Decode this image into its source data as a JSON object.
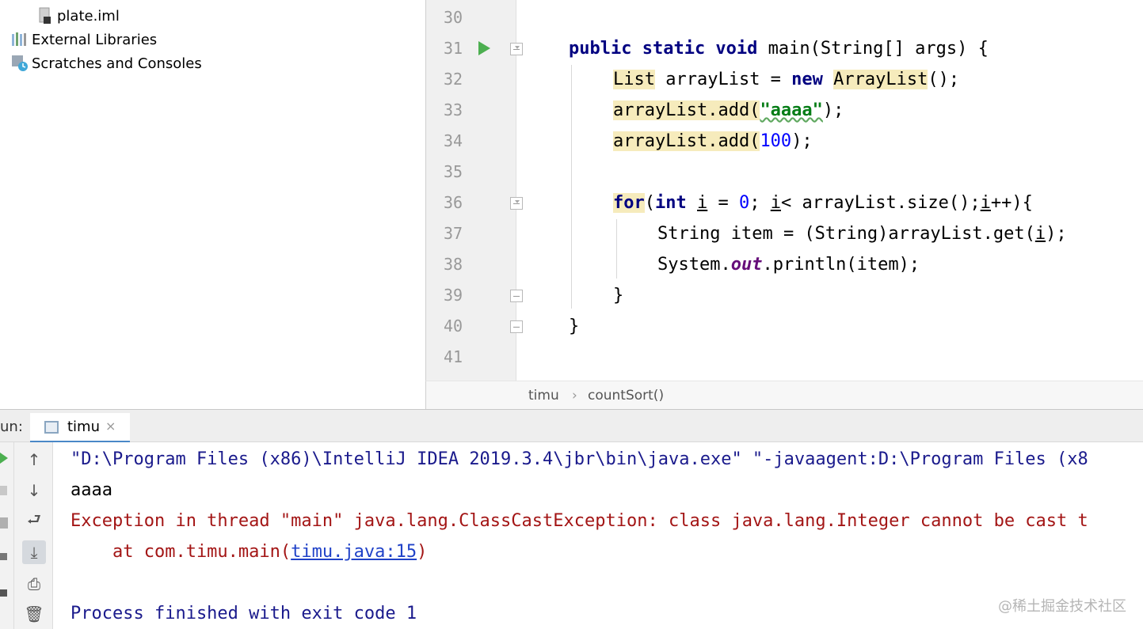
{
  "project_tree": {
    "items": [
      {
        "label": "plate.iml",
        "icon": "iml-file-icon"
      },
      {
        "label": "External Libraries",
        "icon": "library-icon"
      },
      {
        "label": "Scratches and Consoles",
        "icon": "scratches-icon"
      }
    ]
  },
  "editor": {
    "line_numbers": [
      "30",
      "31",
      "32",
      "33",
      "34",
      "35",
      "36",
      "37",
      "38",
      "39",
      "40",
      "41"
    ],
    "code": {
      "l31": {
        "kw1": "public static void",
        "rest": " main(String[] args) {"
      },
      "l32": {
        "t1": "List",
        "t2": " arrayList = ",
        "kw": "new",
        "t3": " ",
        "t4": "ArrayList",
        "t5": "();"
      },
      "l33": {
        "t1": "arrayList.add(",
        "s": "\"aaaa\"",
        "t2": ");"
      },
      "l34": {
        "t1": "arrayList.add(",
        "n": "100",
        "t2": ");"
      },
      "l36": {
        "kw1": "for",
        "t1": "(",
        "kw2": "int",
        "t2": " ",
        "v1": "i",
        "t3": " = ",
        "n": "0",
        "t4": "; ",
        "v2": "i",
        "t5": "< arrayList.size();",
        "v3": "i",
        "t6": "++){"
      },
      "l37": {
        "t1": "String item = (String)arrayList.get(",
        "v": "i",
        "t2": ");"
      },
      "l38": {
        "t1": "System.",
        "f": "out",
        "t2": ".println(item);"
      },
      "l39": {
        "t1": "}"
      },
      "l40": {
        "t1": "}"
      }
    }
  },
  "breadcrumb": {
    "class_name": "timu",
    "separator": "›",
    "method": "countSort()"
  },
  "run_panel": {
    "label": "un:",
    "tab_label": "timu",
    "tab_close": "×",
    "console": {
      "line1": "\"D:\\Program Files (x86)\\IntelliJ IDEA 2019.3.4\\jbr\\bin\\java.exe\" \"-javaagent:D:\\Program Files (x8",
      "line2": "aaaa",
      "line3": "Exception in thread \"main\" java.lang.ClassCastException: class java.lang.Integer cannot be cast t",
      "line4_prefix": "    at com.timu.main(",
      "line4_link": "timu.java:15",
      "line4_suffix": ")",
      "line6": "Process finished with exit code 1"
    }
  },
  "toolbar": {
    "up": "↑",
    "down": "↓",
    "wrap": "⮐",
    "scroll_end": "⤓",
    "print": "⎙",
    "trash": "🗑"
  },
  "watermark": "@稀土掘金技术社区"
}
